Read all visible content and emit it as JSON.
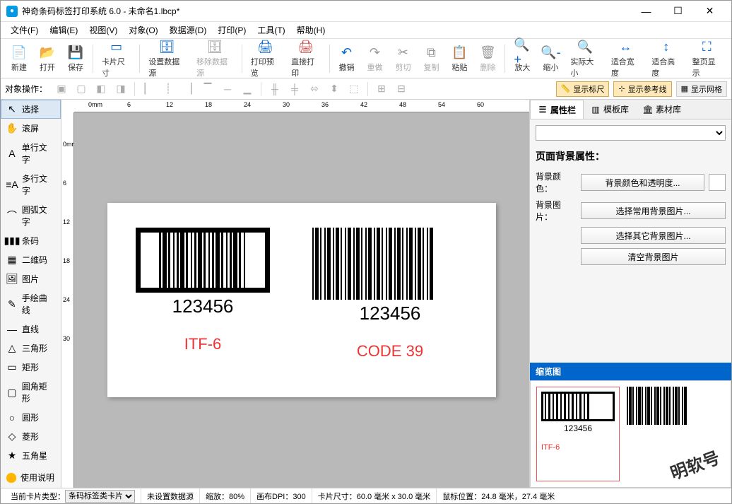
{
  "window": {
    "title": "神奇条码标签打印系统 6.0 - 未命名1.lbcp*"
  },
  "menu": [
    "文件(F)",
    "编辑(E)",
    "视图(V)",
    "对象(O)",
    "数据源(D)",
    "打印(P)",
    "工具(T)",
    "帮助(H)"
  ],
  "toolbar": [
    {
      "id": "new",
      "label": "新建"
    },
    {
      "id": "open",
      "label": "打开"
    },
    {
      "id": "save",
      "label": "保存"
    },
    {
      "sep": true
    },
    {
      "id": "cardsize",
      "label": "卡片尺寸"
    },
    {
      "sep": true
    },
    {
      "id": "setds",
      "label": "设置数据源"
    },
    {
      "id": "removeds",
      "label": "移除数据源",
      "disabled": true
    },
    {
      "sep": true
    },
    {
      "id": "preview",
      "label": "打印预览"
    },
    {
      "id": "print",
      "label": "直接打印",
      "red": true
    },
    {
      "sep": true
    },
    {
      "id": "undo",
      "label": "撤销"
    },
    {
      "id": "redo",
      "label": "重做",
      "disabled": true
    },
    {
      "id": "cut",
      "label": "剪切",
      "disabled": true
    },
    {
      "id": "copy",
      "label": "复制",
      "disabled": true
    },
    {
      "id": "paste",
      "label": "粘贴"
    },
    {
      "id": "delete",
      "label": "删除",
      "disabled": true
    },
    {
      "sep": true
    },
    {
      "id": "zoomin",
      "label": "放大"
    },
    {
      "id": "zoomout",
      "label": "缩小"
    },
    {
      "id": "actual",
      "label": "实际大小"
    },
    {
      "id": "fitw",
      "label": "适合宽度"
    },
    {
      "id": "fith",
      "label": "适合高度"
    },
    {
      "id": "fitpage",
      "label": "整页显示"
    }
  ],
  "objtoolbar": {
    "label": "对象操作："
  },
  "toggles": {
    "ruler": "显示标尺",
    "guides": "显示参考线",
    "grid": "显示网格"
  },
  "palette": [
    {
      "id": "select",
      "label": "选择",
      "active": true
    },
    {
      "id": "pan",
      "label": "滚屏"
    },
    {
      "id": "text",
      "label": "单行文字"
    },
    {
      "id": "mtext",
      "label": "多行文字"
    },
    {
      "id": "arctext",
      "label": "圆弧文字"
    },
    {
      "id": "barcode",
      "label": "条码"
    },
    {
      "id": "qrcode",
      "label": "二维码"
    },
    {
      "id": "image",
      "label": "图片"
    },
    {
      "id": "freehand",
      "label": "手绘曲线"
    },
    {
      "id": "line",
      "label": "直线"
    },
    {
      "id": "triangle",
      "label": "三角形"
    },
    {
      "id": "rect",
      "label": "矩形"
    },
    {
      "id": "roundrect",
      "label": "圆角矩形"
    },
    {
      "id": "ellipse",
      "label": "圆形"
    },
    {
      "id": "diamond",
      "label": "菱形"
    },
    {
      "id": "star",
      "label": "五角星"
    }
  ],
  "help_label": "使用说明",
  "ruler_h": [
    "0mm",
    "6",
    "12",
    "18",
    "24",
    "30",
    "36",
    "42",
    "48",
    "54",
    "60"
  ],
  "ruler_v": [
    "0mm",
    "6",
    "12",
    "18",
    "24",
    "30"
  ],
  "canvas": {
    "barcode1": {
      "text": "123456",
      "label": "ITF-6"
    },
    "barcode2": {
      "text": "123456",
      "label": "CODE 39"
    }
  },
  "tabs": {
    "prop": "属性栏",
    "tpl": "模板库",
    "res": "素材库"
  },
  "props": {
    "section": "页面背景属性：",
    "bgcolor_label": "背景颜色：",
    "bgcolor_btn": "背景颜色和透明度...",
    "bgimg_label": "背景图片：",
    "bgimg_btn1": "选择常用背景图片...",
    "bgimg_btn2": "选择其它背景图片...",
    "bgimg_clear": "清空背景图片"
  },
  "preview": {
    "title": "缩览图",
    "text": "123456",
    "label": "ITF-6",
    "watermark": "明软号"
  },
  "status": {
    "cardtype_label": "当前卡片类型：",
    "cardtype": "条码标签类卡片",
    "ds": "未设置数据源",
    "zoom": "缩放：80%",
    "dpi": "画布DPI：300",
    "size": "卡片尺寸：60.0 毫米 x 30.0 毫米",
    "mouse": "鼠标位置：24.8 毫米，27.4 毫米"
  }
}
